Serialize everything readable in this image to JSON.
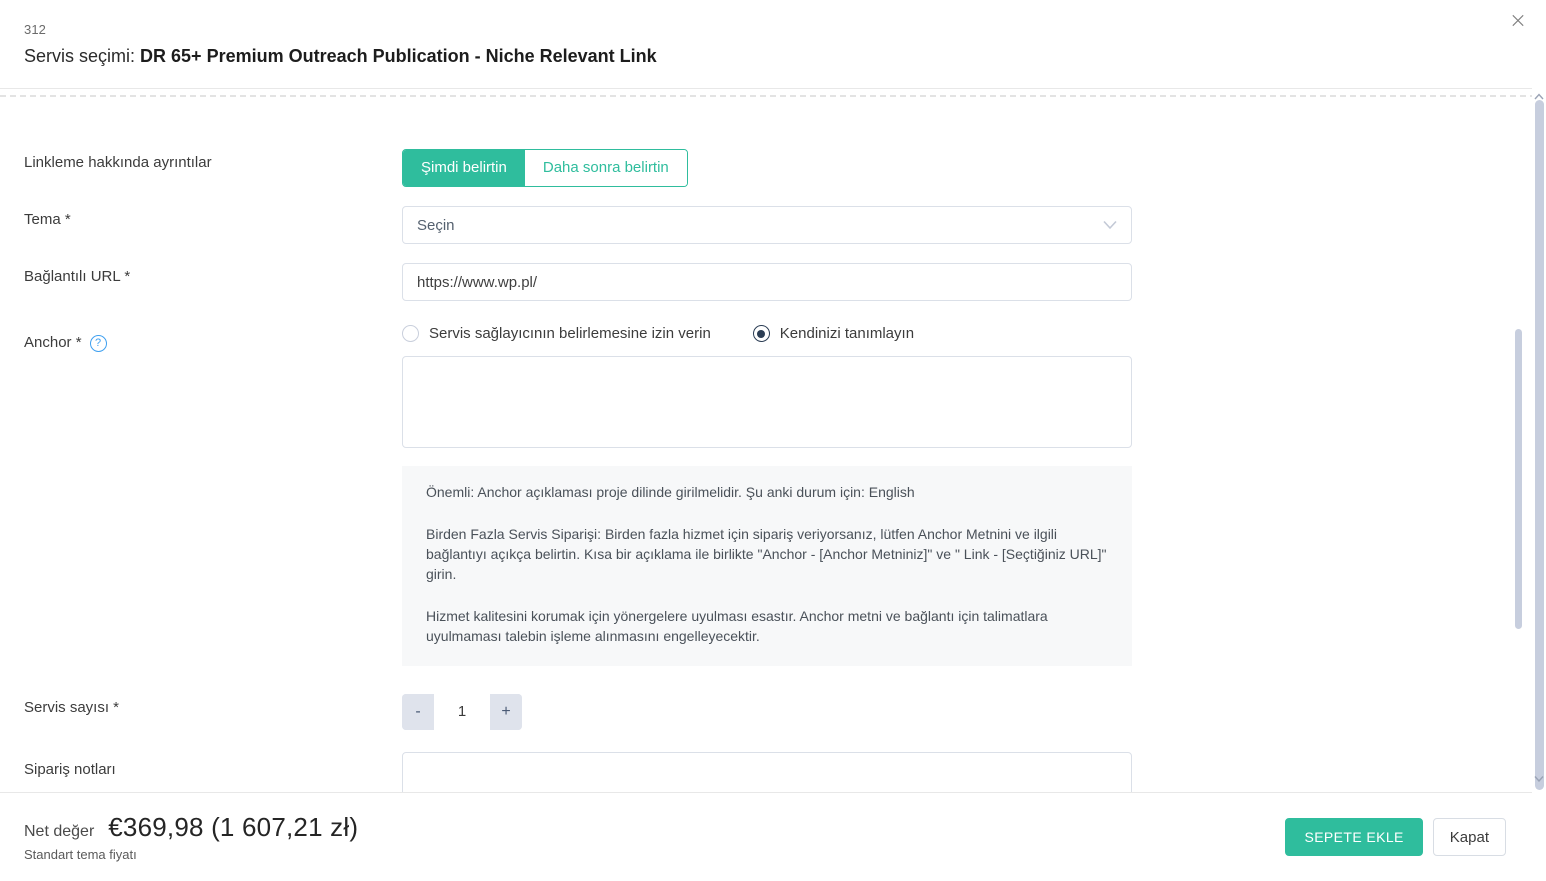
{
  "header": {
    "id": "312",
    "title_prefix": "Servis seçimi:",
    "title_strong": "DR 65+ Premium Outreach Publication - Niche Relevant Link",
    "close_label": "×"
  },
  "form": {
    "linking_details": {
      "label": "Linkleme hakkında ayrıntılar",
      "options": [
        {
          "label": "Şimdi belirtin",
          "active": true
        },
        {
          "label": "Daha sonra belirtin",
          "active": false
        }
      ]
    },
    "theme": {
      "label": "Tema *",
      "value": "Seçin",
      "placeholder": "Seçin"
    },
    "url": {
      "label": "Bağlantılı URL *",
      "value": "https://www.wp.pl/",
      "placeholder": ""
    },
    "anchor": {
      "label": "Anchor *",
      "help_icon": "?",
      "radios": [
        {
          "label": "Servis sağlayıcının belirlemesine izin verin",
          "checked": false
        },
        {
          "label": "Kendinizi tanımlayın",
          "checked": true
        }
      ],
      "textarea_value": "",
      "textarea_placeholder": "",
      "info": [
        "Önemli: Anchor açıklaması proje dilinde girilmelidir. Şu anki durum için: English",
        "Birden Fazla Servis Siparişi: Birden fazla hizmet için sipariş veriyorsanız, lütfen Anchor Metnini ve ilgili bağlantıyı açıkça belirtin. Kısa bir açıklama ile birlikte \"Anchor - [Anchor Metniniz]\" ve \" Link - [Seçtiğiniz URL]\" girin.",
        "Hizmet kalitesini korumak için yönergelere uyulması esastır. Anchor metni ve bağlantı için talimatlara uyulmaması talebin işleme alınmasını engelleyecektir."
      ]
    },
    "service_count": {
      "label": "Servis sayısı *",
      "decrement": "-",
      "value": "1",
      "increment": "+"
    },
    "order_notes": {
      "label": "Sipariş notları",
      "value": "",
      "placeholder": ""
    }
  },
  "footer": {
    "price_label": "Net değer",
    "price_value": "€369,98 (1 607,21 zł)",
    "price_sub": "Standart tema fiyatı",
    "primary_button": "SEPETE EKLE",
    "secondary_button": "Kapat"
  },
  "colors": {
    "accent_teal": "#2fbd9d",
    "help_blue": "#3fa0f0",
    "radio_checked": "#2c3e55",
    "border": "#dbe0e8",
    "info_bg": "#f7f8f9"
  }
}
